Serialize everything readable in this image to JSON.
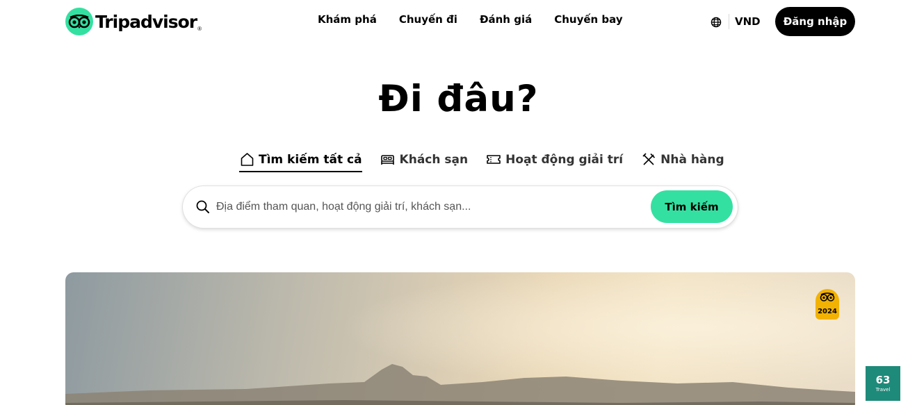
{
  "header": {
    "logo_text": "Tripadvisor",
    "logo_registered": "®",
    "nav": [
      {
        "label": "Khám phá"
      },
      {
        "label": "Chuyến đi"
      },
      {
        "label": "Đánh giá"
      },
      {
        "label": "Chuyến bay"
      }
    ],
    "globe_icon": "globe-icon",
    "currency": "VND",
    "login_label": "Đăng nhập"
  },
  "hero": {
    "title": "Đi đâu?"
  },
  "tabs": [
    {
      "label": "Tìm kiếm tất cả",
      "icon": "home-icon",
      "active": true
    },
    {
      "label": "Khách sạn",
      "icon": "bed-icon",
      "active": false
    },
    {
      "label": "Hoạt động giải trí",
      "icon": "ticket-icon",
      "active": false
    },
    {
      "label": "Nhà hàng",
      "icon": "fork-knife-icon",
      "active": false
    }
  ],
  "search": {
    "placeholder": "Địa điểm tham quan, hoạt động giải trí, khách sạn...",
    "value": "",
    "button_label": "Tìm kiếm"
  },
  "award_badge": {
    "year": "2024"
  },
  "widget": {
    "number": "63",
    "label": "Travel"
  },
  "colors": {
    "brand_green": "#34e0a1",
    "button_black": "#000000",
    "badge_yellow": "#f2b203",
    "widget_teal": "#1e8a7a"
  }
}
